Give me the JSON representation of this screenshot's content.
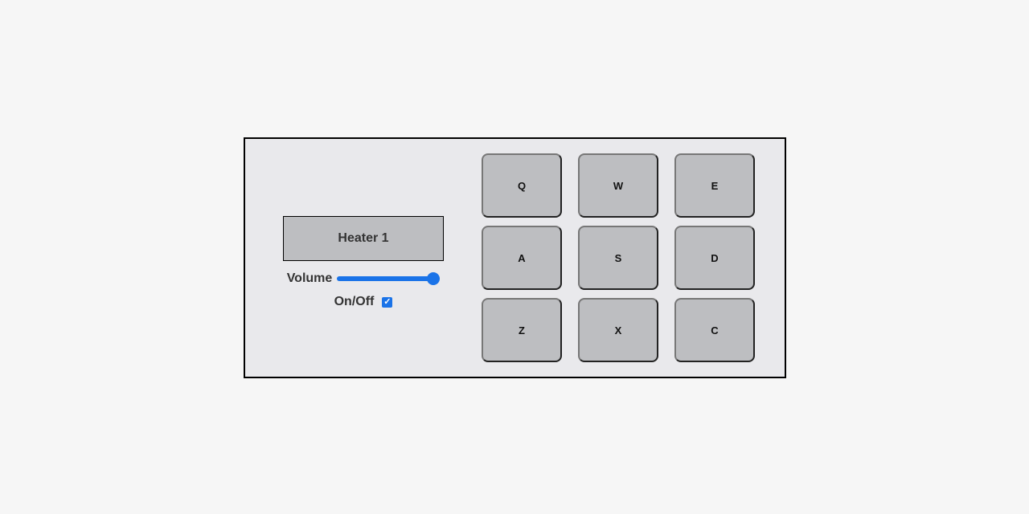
{
  "display": {
    "text": "Heater 1"
  },
  "controls": {
    "volume_label": "Volume",
    "volume_value_fraction": 1.0,
    "power_label": "On/Off",
    "power_checked": true,
    "check_glyph": "✓"
  },
  "pads": [
    {
      "key": "Q"
    },
    {
      "key": "W"
    },
    {
      "key": "E"
    },
    {
      "key": "A"
    },
    {
      "key": "S"
    },
    {
      "key": "D"
    },
    {
      "key": "Z"
    },
    {
      "key": "X"
    },
    {
      "key": "C"
    }
  ],
  "colors": {
    "accent": "#1a73e8",
    "pad_bg": "#bdbec1",
    "panel_bg": "#e9e9ec",
    "page_bg": "#f6f6f6"
  }
}
